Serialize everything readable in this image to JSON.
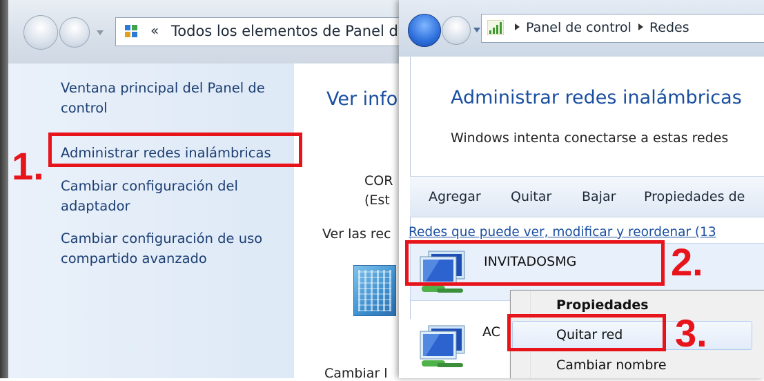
{
  "left_window": {
    "address": {
      "breadcrumb_chevron": "«",
      "text": "Todos los elementos de Panel d"
    },
    "sidebar_links": [
      {
        "label_line1": "Ventana principal del Panel de",
        "label_line2": "control"
      },
      {
        "label_line1": "Administrar redes inalámbricas",
        "label_line2": ""
      },
      {
        "label_line1": "Cambiar configuración del",
        "label_line2": "adaptador"
      },
      {
        "label_line1": "Cambiar configuración de uso",
        "label_line2": "compartido avanzado"
      }
    ],
    "main": {
      "heading": "Ver info",
      "network_line1": "COR",
      "network_line2": "(Est",
      "ver_las": "Ver las rec",
      "cambiar": "Cambiar l"
    }
  },
  "right_window": {
    "address": {
      "segment1": "Panel de control",
      "segment2": "Redes"
    },
    "heading": "Administrar redes inalámbricas",
    "subheading": "Windows intenta conectarse a estas redes",
    "toolbar": [
      "Agregar",
      "Quitar",
      "Bajar",
      "Propiedades de"
    ],
    "networks_link": "Redes que puede ver, modificar y reordenar (13",
    "networks": [
      "INVITADOSMG",
      "AC"
    ],
    "context_menu": [
      "Propiedades",
      "Quitar red",
      "Cambiar nombre"
    ]
  },
  "annotations": {
    "step1": "1.",
    "step2": "2.",
    "step3": "3.",
    "color": "#e8141c"
  },
  "icons": {
    "back": "back-arrow-icon",
    "forward": "forward-arrow-icon",
    "control_panel": "control-panel-icon",
    "signal": "wireless-signal-icon",
    "network_computer": "network-computer-icon",
    "building": "network-building-icon"
  }
}
